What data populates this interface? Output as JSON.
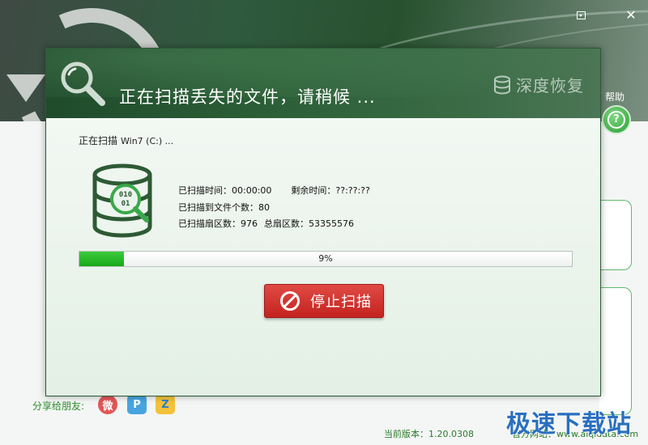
{
  "window": {
    "menu_icon": "menu-dropdown-icon",
    "close_label": "✕"
  },
  "help": {
    "label": "帮助",
    "icon_glyph": "?"
  },
  "dialog": {
    "title": "正在扫描丢失的文件，请稍候 ...",
    "brand": "深度恢复",
    "scanning_prefix": "正在扫描",
    "scanning_drive": "Win7 (C:) ...",
    "stats": {
      "elapsed_label": "已扫描时间：",
      "elapsed_value": "00:00:00",
      "remaining_label": "剩余时间：",
      "remaining_value": "??:??:??",
      "files_label": "已扫描到文件个数：",
      "files_value": "80",
      "sectors_label": "已扫描扇区数：",
      "sectors_value": "976",
      "total_sectors_label": "总扇区数：",
      "total_sectors_value": "53355576"
    },
    "progress": {
      "percent": 9,
      "text": "9%"
    },
    "stop_button": "停止扫描"
  },
  "footer": {
    "share_label": "分享给朋友:",
    "share_items": [
      {
        "name": "weibo",
        "glyph": "微"
      },
      {
        "name": "tencent",
        "glyph": "P"
      },
      {
        "name": "qzone",
        "glyph": "Z"
      }
    ],
    "version": "当前版本：1.20.0308",
    "site": "官方网站：www.aiqidata.com",
    "watermark": "极速下载站"
  },
  "colors": {
    "header_green": "#2c5f37",
    "progress_green": "#18a818",
    "stop_red": "#c4231f",
    "accent_green": "#2a8a2a"
  }
}
